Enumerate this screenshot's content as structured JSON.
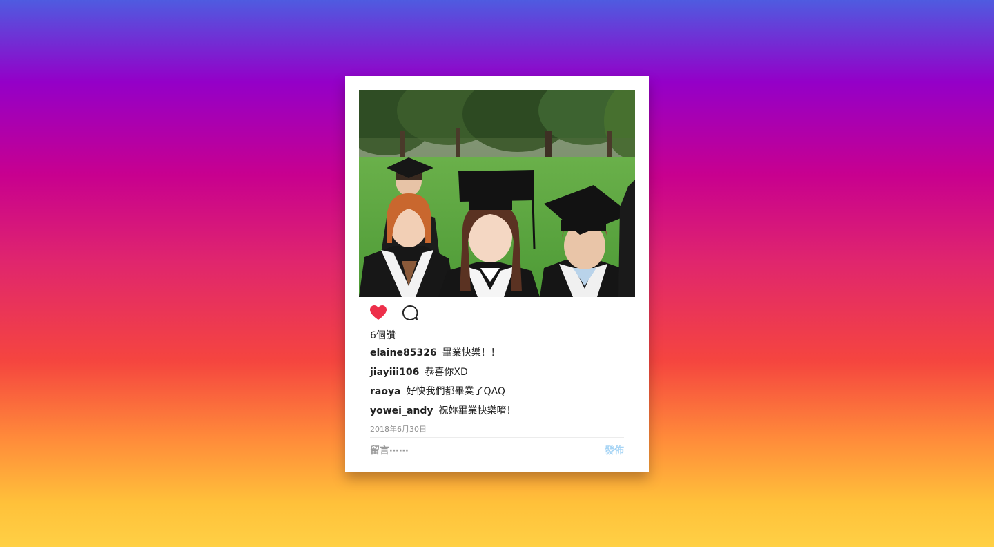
{
  "post": {
    "likes_text": "6個讚",
    "date": "2018年6月30日",
    "comments": [
      {
        "user": "elaine85326",
        "text": "畢業快樂！！"
      },
      {
        "user": "jiayiii106",
        "text": "恭喜你XD"
      },
      {
        "user": "raoya",
        "text": "好快我們都畢業了QAQ"
      },
      {
        "user": "yowei_andy",
        "text": "祝妳畢業快樂唷！"
      }
    ],
    "comment_placeholder": "留言⋯⋯",
    "post_button_label": "發佈"
  },
  "icons": {
    "like": "heart-icon",
    "comment": "comment-bubble-icon"
  },
  "colors": {
    "like": "#ed2f4a",
    "post_button": "#a8d5f5"
  }
}
